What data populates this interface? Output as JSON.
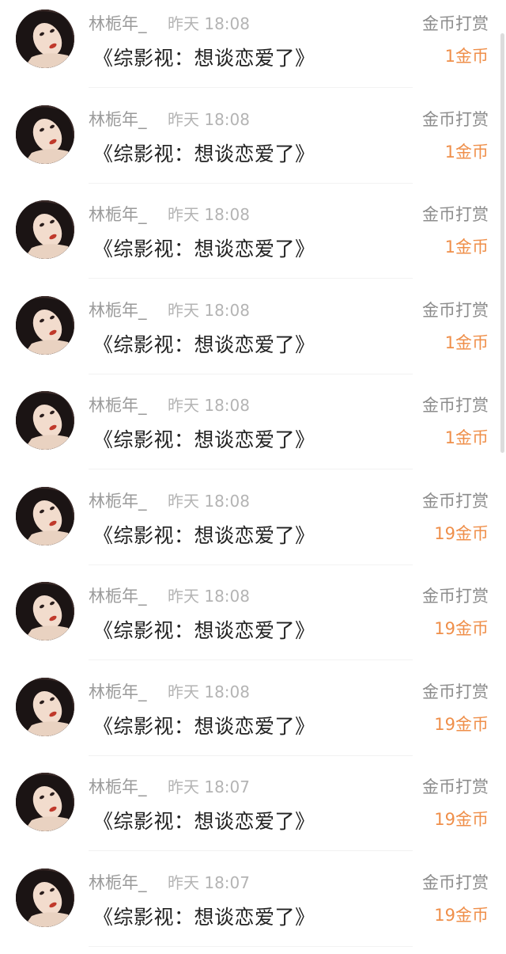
{
  "colors": {
    "username": "#9a9a9a",
    "time": "#b4b4b4",
    "book_title": "#222222",
    "type_label": "#8c8c8c",
    "amount": "#ef8f4a"
  },
  "rewards": [
    {
      "username": "林栀年_",
      "time": "昨天 18:08",
      "book": "《综影视：想谈恋爱了》",
      "type": "金币打赏",
      "amount": "1金币",
      "avatar_icon": "user-avatar-icon"
    },
    {
      "username": "林栀年_",
      "time": "昨天 18:08",
      "book": "《综影视：想谈恋爱了》",
      "type": "金币打赏",
      "amount": "1金币",
      "avatar_icon": "user-avatar-icon"
    },
    {
      "username": "林栀年_",
      "time": "昨天 18:08",
      "book": "《综影视：想谈恋爱了》",
      "type": "金币打赏",
      "amount": "1金币",
      "avatar_icon": "user-avatar-icon"
    },
    {
      "username": "林栀年_",
      "time": "昨天 18:08",
      "book": "《综影视：想谈恋爱了》",
      "type": "金币打赏",
      "amount": "1金币",
      "avatar_icon": "user-avatar-icon"
    },
    {
      "username": "林栀年_",
      "time": "昨天 18:08",
      "book": "《综影视：想谈恋爱了》",
      "type": "金币打赏",
      "amount": "1金币",
      "avatar_icon": "user-avatar-icon"
    },
    {
      "username": "林栀年_",
      "time": "昨天 18:08",
      "book": "《综影视：想谈恋爱了》",
      "type": "金币打赏",
      "amount": "19金币",
      "avatar_icon": "user-avatar-icon"
    },
    {
      "username": "林栀年_",
      "time": "昨天 18:08",
      "book": "《综影视：想谈恋爱了》",
      "type": "金币打赏",
      "amount": "19金币",
      "avatar_icon": "user-avatar-icon"
    },
    {
      "username": "林栀年_",
      "time": "昨天 18:08",
      "book": "《综影视：想谈恋爱了》",
      "type": "金币打赏",
      "amount": "19金币",
      "avatar_icon": "user-avatar-icon"
    },
    {
      "username": "林栀年_",
      "time": "昨天 18:07",
      "book": "《综影视：想谈恋爱了》",
      "type": "金币打赏",
      "amount": "19金币",
      "avatar_icon": "user-avatar-icon"
    },
    {
      "username": "林栀年_",
      "time": "昨天 18:07",
      "book": "《综影视：想谈恋爱了》",
      "type": "金币打赏",
      "amount": "19金币",
      "avatar_icon": "user-avatar-icon"
    }
  ]
}
